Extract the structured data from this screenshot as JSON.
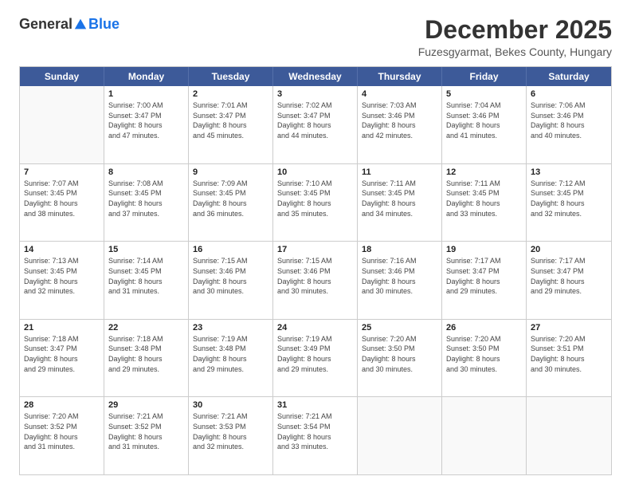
{
  "header": {
    "logo_general": "General",
    "logo_blue": "Blue",
    "month_title": "December 2025",
    "subtitle": "Fuzesgyarmat, Bekes County, Hungary"
  },
  "days_of_week": [
    "Sunday",
    "Monday",
    "Tuesday",
    "Wednesday",
    "Thursday",
    "Friday",
    "Saturday"
  ],
  "weeks": [
    [
      {
        "day": "",
        "sunrise": "",
        "sunset": "",
        "daylight": ""
      },
      {
        "day": "1",
        "sunrise": "Sunrise: 7:00 AM",
        "sunset": "Sunset: 3:47 PM",
        "daylight": "Daylight: 8 hours and 47 minutes."
      },
      {
        "day": "2",
        "sunrise": "Sunrise: 7:01 AM",
        "sunset": "Sunset: 3:47 PM",
        "daylight": "Daylight: 8 hours and 45 minutes."
      },
      {
        "day": "3",
        "sunrise": "Sunrise: 7:02 AM",
        "sunset": "Sunset: 3:47 PM",
        "daylight": "Daylight: 8 hours and 44 minutes."
      },
      {
        "day": "4",
        "sunrise": "Sunrise: 7:03 AM",
        "sunset": "Sunset: 3:46 PM",
        "daylight": "Daylight: 8 hours and 42 minutes."
      },
      {
        "day": "5",
        "sunrise": "Sunrise: 7:04 AM",
        "sunset": "Sunset: 3:46 PM",
        "daylight": "Daylight: 8 hours and 41 minutes."
      },
      {
        "day": "6",
        "sunrise": "Sunrise: 7:06 AM",
        "sunset": "Sunset: 3:46 PM",
        "daylight": "Daylight: 8 hours and 40 minutes."
      }
    ],
    [
      {
        "day": "7",
        "sunrise": "Sunrise: 7:07 AM",
        "sunset": "Sunset: 3:45 PM",
        "daylight": "Daylight: 8 hours and 38 minutes."
      },
      {
        "day": "8",
        "sunrise": "Sunrise: 7:08 AM",
        "sunset": "Sunset: 3:45 PM",
        "daylight": "Daylight: 8 hours and 37 minutes."
      },
      {
        "day": "9",
        "sunrise": "Sunrise: 7:09 AM",
        "sunset": "Sunset: 3:45 PM",
        "daylight": "Daylight: 8 hours and 36 minutes."
      },
      {
        "day": "10",
        "sunrise": "Sunrise: 7:10 AM",
        "sunset": "Sunset: 3:45 PM",
        "daylight": "Daylight: 8 hours and 35 minutes."
      },
      {
        "day": "11",
        "sunrise": "Sunrise: 7:11 AM",
        "sunset": "Sunset: 3:45 PM",
        "daylight": "Daylight: 8 hours and 34 minutes."
      },
      {
        "day": "12",
        "sunrise": "Sunrise: 7:11 AM",
        "sunset": "Sunset: 3:45 PM",
        "daylight": "Daylight: 8 hours and 33 minutes."
      },
      {
        "day": "13",
        "sunrise": "Sunrise: 7:12 AM",
        "sunset": "Sunset: 3:45 PM",
        "daylight": "Daylight: 8 hours and 32 minutes."
      }
    ],
    [
      {
        "day": "14",
        "sunrise": "Sunrise: 7:13 AM",
        "sunset": "Sunset: 3:45 PM",
        "daylight": "Daylight: 8 hours and 32 minutes."
      },
      {
        "day": "15",
        "sunrise": "Sunrise: 7:14 AM",
        "sunset": "Sunset: 3:45 PM",
        "daylight": "Daylight: 8 hours and 31 minutes."
      },
      {
        "day": "16",
        "sunrise": "Sunrise: 7:15 AM",
        "sunset": "Sunset: 3:46 PM",
        "daylight": "Daylight: 8 hours and 30 minutes."
      },
      {
        "day": "17",
        "sunrise": "Sunrise: 7:15 AM",
        "sunset": "Sunset: 3:46 PM",
        "daylight": "Daylight: 8 hours and 30 minutes."
      },
      {
        "day": "18",
        "sunrise": "Sunrise: 7:16 AM",
        "sunset": "Sunset: 3:46 PM",
        "daylight": "Daylight: 8 hours and 30 minutes."
      },
      {
        "day": "19",
        "sunrise": "Sunrise: 7:17 AM",
        "sunset": "Sunset: 3:47 PM",
        "daylight": "Daylight: 8 hours and 29 minutes."
      },
      {
        "day": "20",
        "sunrise": "Sunrise: 7:17 AM",
        "sunset": "Sunset: 3:47 PM",
        "daylight": "Daylight: 8 hours and 29 minutes."
      }
    ],
    [
      {
        "day": "21",
        "sunrise": "Sunrise: 7:18 AM",
        "sunset": "Sunset: 3:47 PM",
        "daylight": "Daylight: 8 hours and 29 minutes."
      },
      {
        "day": "22",
        "sunrise": "Sunrise: 7:18 AM",
        "sunset": "Sunset: 3:48 PM",
        "daylight": "Daylight: 8 hours and 29 minutes."
      },
      {
        "day": "23",
        "sunrise": "Sunrise: 7:19 AM",
        "sunset": "Sunset: 3:48 PM",
        "daylight": "Daylight: 8 hours and 29 minutes."
      },
      {
        "day": "24",
        "sunrise": "Sunrise: 7:19 AM",
        "sunset": "Sunset: 3:49 PM",
        "daylight": "Daylight: 8 hours and 29 minutes."
      },
      {
        "day": "25",
        "sunrise": "Sunrise: 7:20 AM",
        "sunset": "Sunset: 3:50 PM",
        "daylight": "Daylight: 8 hours and 30 minutes."
      },
      {
        "day": "26",
        "sunrise": "Sunrise: 7:20 AM",
        "sunset": "Sunset: 3:50 PM",
        "daylight": "Daylight: 8 hours and 30 minutes."
      },
      {
        "day": "27",
        "sunrise": "Sunrise: 7:20 AM",
        "sunset": "Sunset: 3:51 PM",
        "daylight": "Daylight: 8 hours and 30 minutes."
      }
    ],
    [
      {
        "day": "28",
        "sunrise": "Sunrise: 7:20 AM",
        "sunset": "Sunset: 3:52 PM",
        "daylight": "Daylight: 8 hours and 31 minutes."
      },
      {
        "day": "29",
        "sunrise": "Sunrise: 7:21 AM",
        "sunset": "Sunset: 3:52 PM",
        "daylight": "Daylight: 8 hours and 31 minutes."
      },
      {
        "day": "30",
        "sunrise": "Sunrise: 7:21 AM",
        "sunset": "Sunset: 3:53 PM",
        "daylight": "Daylight: 8 hours and 32 minutes."
      },
      {
        "day": "31",
        "sunrise": "Sunrise: 7:21 AM",
        "sunset": "Sunset: 3:54 PM",
        "daylight": "Daylight: 8 hours and 33 minutes."
      },
      {
        "day": "",
        "sunrise": "",
        "sunset": "",
        "daylight": ""
      },
      {
        "day": "",
        "sunrise": "",
        "sunset": "",
        "daylight": ""
      },
      {
        "day": "",
        "sunrise": "",
        "sunset": "",
        "daylight": ""
      }
    ]
  ]
}
